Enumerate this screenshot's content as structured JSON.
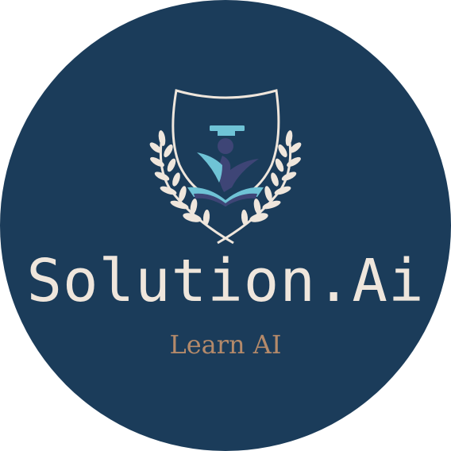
{
  "logo": {
    "title": "Solution.Ai",
    "tagline": "Learn AI",
    "icons": [
      "shield-icon",
      "graduate-icon",
      "laurel-wreath-icon",
      "open-book-icon"
    ]
  },
  "colors": {
    "badge_background": "#1b3c5a",
    "title_text": "#efe6dc",
    "tagline_text": "#b58a6a",
    "accent_cyan": "#6fc3d6",
    "figure_purple": "#3e4576",
    "laurel": "#efe6dc"
  }
}
